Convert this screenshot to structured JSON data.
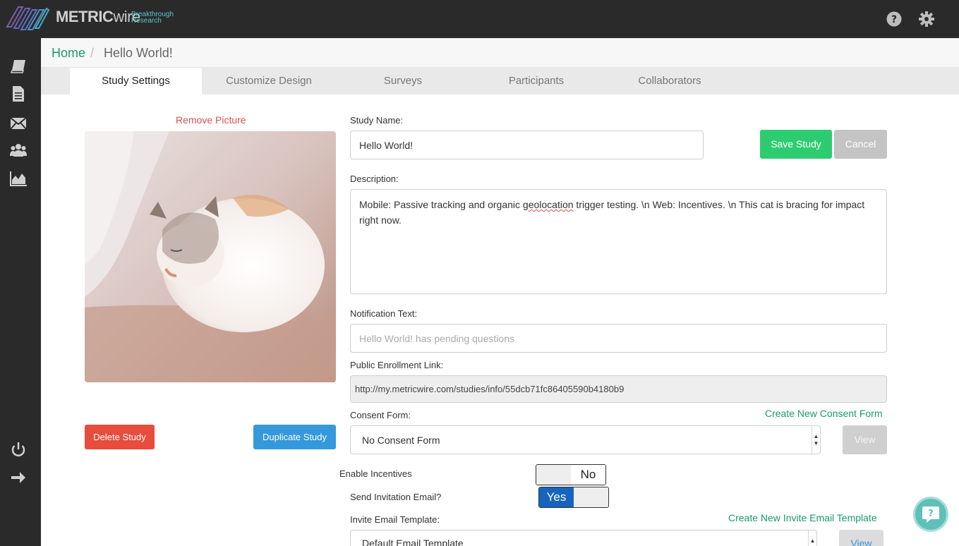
{
  "brand": {
    "name_bold": "METRIC",
    "name_light": "wire",
    "tagline_1": "Breakthrough",
    "tagline_2": "Research"
  },
  "topbar": {
    "icons": [
      "help-icon",
      "gear-icon"
    ]
  },
  "sidebar": {
    "icons": [
      "book-icon",
      "document-icon",
      "envelope-icon",
      "users-icon",
      "chart-icon",
      "power-icon",
      "arrow-right-icon"
    ]
  },
  "breadcrumb": {
    "home": "Home",
    "separator": "/",
    "current": "Hello World!"
  },
  "tabs": [
    "Study Settings",
    "Customize Design",
    "Surveys",
    "Participants",
    "Collaborators"
  ],
  "picture": {
    "remove_label": "Remove Picture",
    "alt": "cat photo"
  },
  "actions": {
    "delete": "Delete Study",
    "duplicate": "Duplicate Study",
    "save": "Save Study",
    "cancel": "Cancel"
  },
  "form": {
    "study_name_label": "Study Name:",
    "study_name_value": "Hello World!",
    "description_label": "Description:",
    "description_part1": "Mobile: Passive tracking and organic ",
    "description_misspelled": "geolocation",
    "description_part2": " trigger testing. \\n Web: Incentives. \\n This cat is bracing for impact right now.",
    "notification_label": "Notification Text:",
    "notification_placeholder": "Hello World! has pending questions",
    "enrollment_label": "Public Enrollment Link:",
    "enrollment_value": "http://my.metricwire.com/studies/info/55dcb71fc86405590b4180b9",
    "consent_label": "Consent Form:",
    "consent_create": "Create New Consent Form",
    "consent_selected": "No Consent Form",
    "view_label": "View",
    "incentives_label": "Enable Incentives",
    "incentives_state": "No",
    "invite_email_label": "Send Invitation Email?",
    "invite_email_state": "Yes",
    "invite_template_label": "Invite Email Template:",
    "invite_template_create": "Create New Invite Email Template",
    "invite_template_selected": "Default Email Template"
  },
  "colors": {
    "accent_green": "#1a9a6b",
    "save_green": "#2ecc71",
    "danger": "#e74c3c",
    "primary_blue": "#3498db",
    "toggle_blue": "#1565c0",
    "dark_bar": "#2a2a2a"
  }
}
